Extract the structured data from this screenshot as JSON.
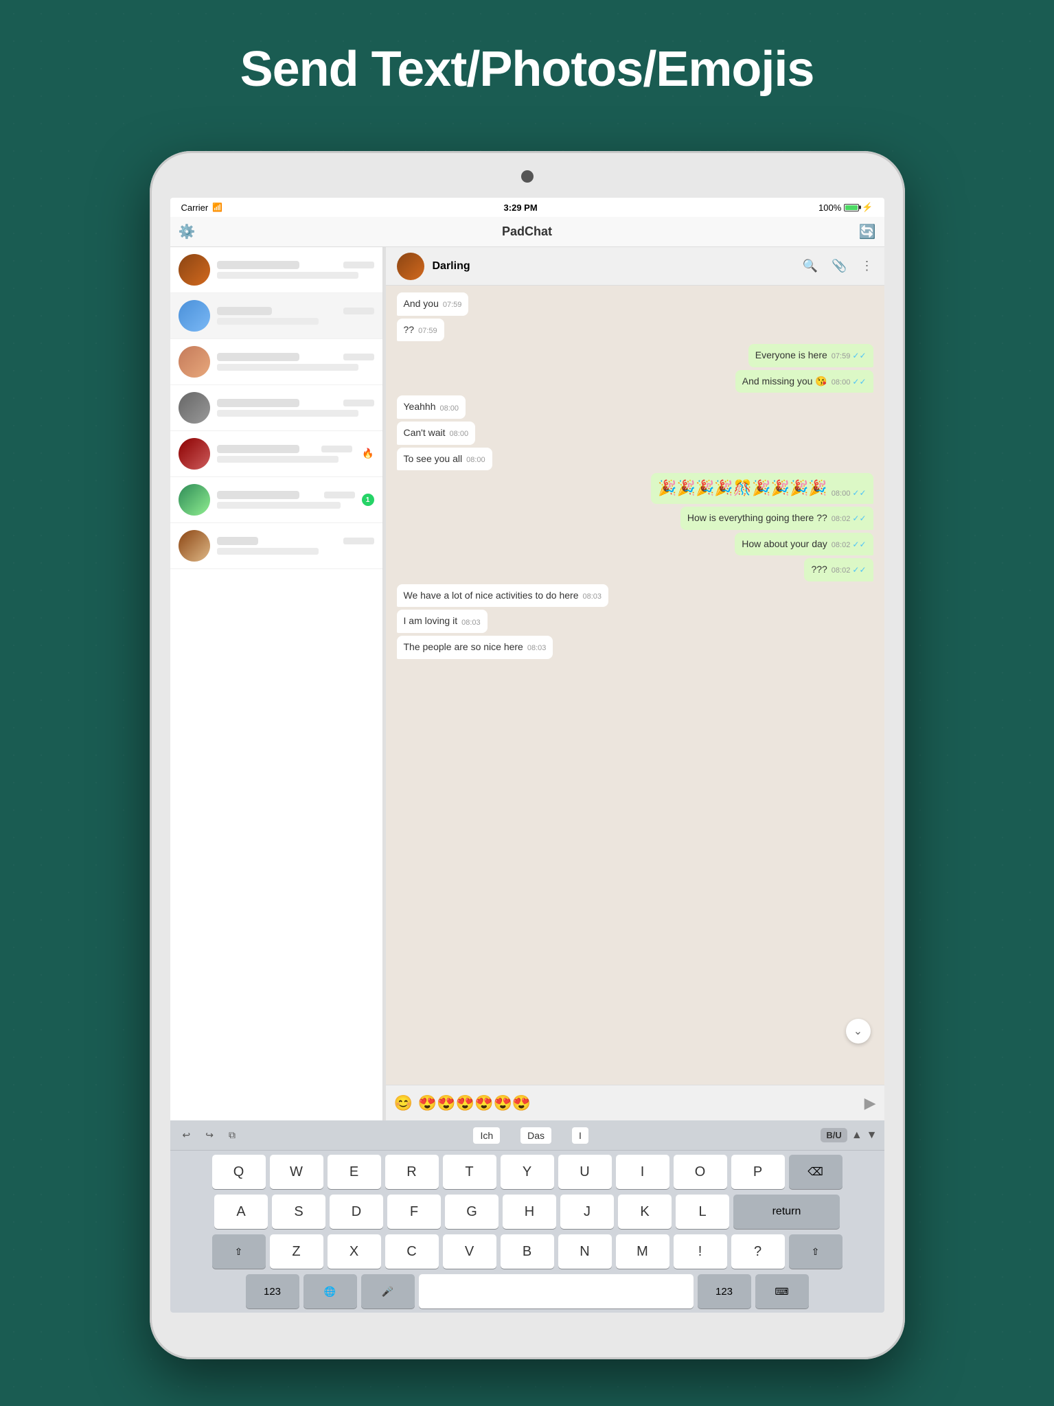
{
  "page": {
    "title": "Send Text/Photos/Emojis",
    "background_color": "#1a5c52"
  },
  "status_bar": {
    "carrier": "Carrier",
    "time": "3:29 PM",
    "battery": "100%"
  },
  "app_header": {
    "title": "PadChat"
  },
  "chat_header": {
    "name": "Darling"
  },
  "sidebar": {
    "items": [
      {
        "id": 1,
        "time": ""
      },
      {
        "id": 2,
        "time": ""
      },
      {
        "id": 3,
        "time": ""
      },
      {
        "id": 4,
        "time": ""
      },
      {
        "id": 5,
        "time": ""
      },
      {
        "id": 6,
        "time": ""
      },
      {
        "id": 7,
        "time": ""
      }
    ]
  },
  "messages": [
    {
      "id": 1,
      "type": "received",
      "text": "And you",
      "time": "07:59",
      "ticks": ""
    },
    {
      "id": 2,
      "type": "received",
      "text": "??",
      "time": "07:59",
      "ticks": ""
    },
    {
      "id": 3,
      "type": "sent",
      "text": "Everyone is here",
      "time": "07:59",
      "ticks": "✓✓"
    },
    {
      "id": 4,
      "type": "sent",
      "text": "And missing you 😘",
      "time": "08:00",
      "ticks": "✓✓"
    },
    {
      "id": 5,
      "type": "received",
      "text": "Yeahhh",
      "time": "08:00",
      "ticks": ""
    },
    {
      "id": 6,
      "type": "received",
      "text": "Can't wait",
      "time": "08:00",
      "ticks": ""
    },
    {
      "id": 7,
      "type": "received",
      "text": "To see you all",
      "time": "08:00",
      "ticks": ""
    },
    {
      "id": 8,
      "type": "sent",
      "text": "🎉🎉🎉🎉🎊🎉🎉🎉🎉",
      "time": "08:00",
      "ticks": "✓✓",
      "emoji": true
    },
    {
      "id": 9,
      "type": "sent",
      "text": "How is everything going there ??",
      "time": "08:02",
      "ticks": "✓✓"
    },
    {
      "id": 10,
      "type": "sent",
      "text": "How about your day",
      "time": "08:02",
      "ticks": "✓✓"
    },
    {
      "id": 11,
      "type": "sent",
      "text": "???",
      "time": "08:02",
      "ticks": "✓✓"
    },
    {
      "id": 12,
      "type": "received",
      "text": "We have a lot of nice activities to do here",
      "time": "08:03",
      "ticks": ""
    },
    {
      "id": 13,
      "type": "received",
      "text": "I am loving it",
      "time": "08:03",
      "ticks": ""
    },
    {
      "id": 14,
      "type": "received",
      "text": "The people are so nice here",
      "time": "08:03",
      "ticks": ""
    }
  ],
  "input": {
    "emoji_icon": "😊",
    "value": "😍😍😍😍😍😍",
    "send_icon": "▶"
  },
  "keyboard": {
    "toolbar": {
      "undo": "↩",
      "redo": "↪",
      "copy": "⧉",
      "suggestions": [
        "Ich",
        "Das",
        "I"
      ],
      "format": "B/U",
      "arrow_up": "▲",
      "arrow_down": "▼"
    },
    "rows": [
      [
        "Q",
        "W",
        "E",
        "R",
        "T",
        "Y",
        "U",
        "I",
        "O",
        "P"
      ],
      [
        "A",
        "S",
        "D",
        "F",
        "G",
        "H",
        "J",
        "K",
        "L"
      ],
      [
        "⇧",
        "Z",
        "X",
        "C",
        "V",
        "B",
        "N",
        "M",
        "!",
        "?",
        "⇧"
      ],
      [
        "123",
        "🌐",
        "🎤",
        "",
        "",
        "",
        "",
        "",
        "",
        "",
        "123",
        "⌨"
      ]
    ],
    "delete": "⌫",
    "return": "return",
    "space": " "
  }
}
